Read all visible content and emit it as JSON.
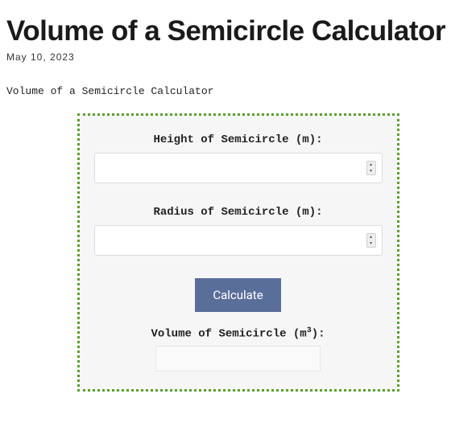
{
  "title": "Volume of a Semicircle Calculator",
  "date": "May 10, 2023",
  "subtitle": "Volume of a Semicircle Calculator",
  "form": {
    "height_label": "Height of Semicircle (m):",
    "height_value": "",
    "radius_label": "Radius of Semicircle (m):",
    "radius_value": "",
    "button_label": "Calculate",
    "result_label_prefix": "Volume of Semicircle (m",
    "result_label_sup": "3",
    "result_label_suffix": "):",
    "result_value": ""
  }
}
